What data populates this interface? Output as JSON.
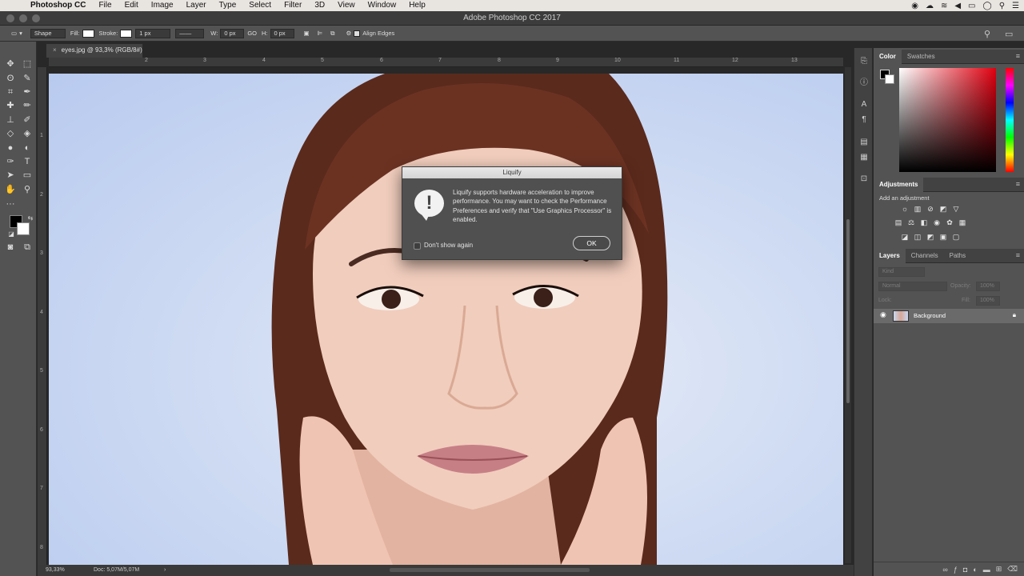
{
  "menubar": {
    "app_name": "Photoshop CC",
    "items": [
      "File",
      "Edit",
      "Image",
      "Layer",
      "Type",
      "Select",
      "Filter",
      "3D",
      "View",
      "Window",
      "Help"
    ]
  },
  "window": {
    "title": "Adobe Photoshop CC 2017"
  },
  "options_bar": {
    "shape_mode": "Shape",
    "fill_label": "Fill:",
    "stroke_label": "Stroke:",
    "stroke_width": "1 px",
    "w_label": "W:",
    "w_value": "0 px",
    "link_label": "GO",
    "h_label": "H:",
    "h_value": "0 px",
    "align_edges": "Align Edges"
  },
  "document": {
    "tab_title": "eyes.jpg @ 93,3% (RGB/8#)",
    "ruler_h": [
      "2",
      "3",
      "4",
      "5",
      "6",
      "7",
      "8",
      "9",
      "10",
      "11",
      "12",
      "13"
    ],
    "ruler_v": [
      "1",
      "2",
      "3",
      "4",
      "5",
      "6",
      "7",
      "8"
    ],
    "zoom": "93,33%",
    "doc_size": "Doc: 5,07M/5,07M"
  },
  "dialog": {
    "title": "Liquify",
    "message": "Liquify supports hardware acceleration to improve performance. You may want to check the Performance Preferences and verify that \"Use Graphics Processor\" is enabled.",
    "checkbox_label": "Don't show again",
    "ok_label": "OK"
  },
  "panels": {
    "color_tabs": [
      "Color",
      "Swatches"
    ],
    "adjustments_title": "Adjustments",
    "adjustments_subtitle": "Add an adjustment",
    "layers_tabs": [
      "Layers",
      "Channels",
      "Paths"
    ],
    "kind_placeholder": "Kind",
    "blend_mode": "Normal",
    "opacity_label": "Opacity:",
    "opacity_value": "100%",
    "lock_label": "Lock:",
    "fill_label": "Fill:",
    "fill_value": "100%",
    "layer_name": "Background"
  }
}
